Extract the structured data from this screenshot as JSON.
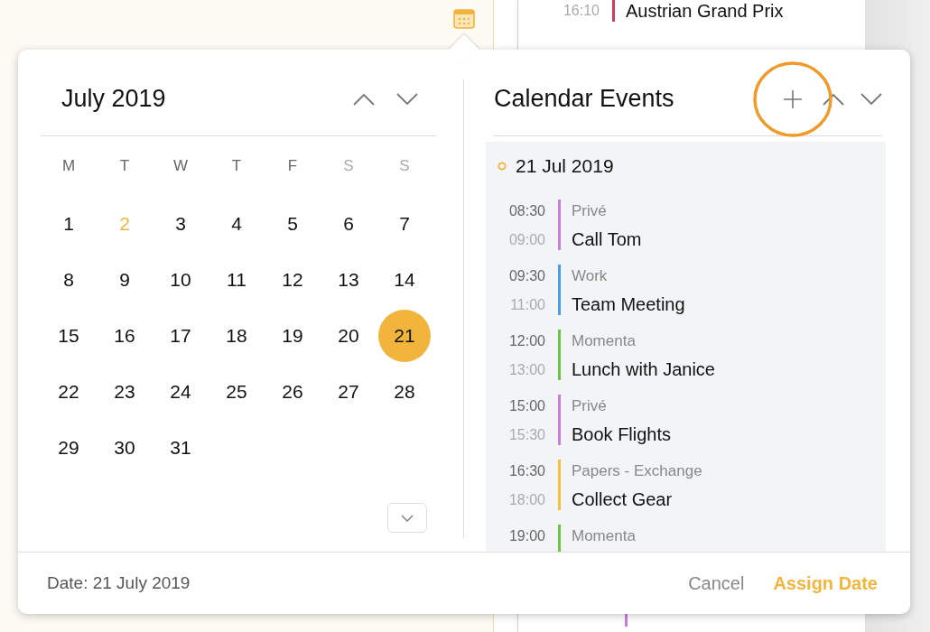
{
  "background": {
    "event_above": {
      "time": "16:10",
      "title": "Austrian Grand Prix",
      "color": "#d8365c"
    },
    "event_below": {
      "color": "#c77fd9"
    }
  },
  "calendar": {
    "month": "July 2019",
    "weekdays": [
      {
        "label": "M",
        "weekend": false
      },
      {
        "label": "T",
        "weekend": false
      },
      {
        "label": "W",
        "weekend": false
      },
      {
        "label": "T",
        "weekend": false
      },
      {
        "label": "F",
        "weekend": false
      },
      {
        "label": "S",
        "weekend": true
      },
      {
        "label": "S",
        "weekend": true
      }
    ],
    "weeks": [
      [
        {
          "label": "1",
          "today": false,
          "selected": false
        },
        {
          "label": "2",
          "today": true,
          "selected": false
        },
        {
          "label": "3",
          "today": false,
          "selected": false
        },
        {
          "label": "4",
          "today": false,
          "selected": false
        },
        {
          "label": "5",
          "today": false,
          "selected": false
        },
        {
          "label": "6",
          "today": false,
          "selected": false
        },
        {
          "label": "7",
          "today": false,
          "selected": false
        }
      ],
      [
        {
          "label": "8",
          "today": false,
          "selected": false
        },
        {
          "label": "9",
          "today": false,
          "selected": false
        },
        {
          "label": "10",
          "today": false,
          "selected": false
        },
        {
          "label": "11",
          "today": false,
          "selected": false
        },
        {
          "label": "12",
          "today": false,
          "selected": false
        },
        {
          "label": "13",
          "today": false,
          "selected": false
        },
        {
          "label": "14",
          "today": false,
          "selected": false
        }
      ],
      [
        {
          "label": "15",
          "today": false,
          "selected": false
        },
        {
          "label": "16",
          "today": false,
          "selected": false
        },
        {
          "label": "17",
          "today": false,
          "selected": false
        },
        {
          "label": "18",
          "today": false,
          "selected": false
        },
        {
          "label": "19",
          "today": false,
          "selected": false
        },
        {
          "label": "20",
          "today": false,
          "selected": false
        },
        {
          "label": "21",
          "today": false,
          "selected": true
        }
      ],
      [
        {
          "label": "22",
          "today": false,
          "selected": false
        },
        {
          "label": "23",
          "today": false,
          "selected": false
        },
        {
          "label": "24",
          "today": false,
          "selected": false
        },
        {
          "label": "25",
          "today": false,
          "selected": false
        },
        {
          "label": "26",
          "today": false,
          "selected": false
        },
        {
          "label": "27",
          "today": false,
          "selected": false
        },
        {
          "label": "28",
          "today": false,
          "selected": false
        }
      ],
      [
        {
          "label": "29",
          "today": false,
          "selected": false
        },
        {
          "label": "30",
          "today": false,
          "selected": false
        },
        {
          "label": "31",
          "today": false,
          "selected": false
        }
      ]
    ]
  },
  "events_panel": {
    "title": "Calendar Events",
    "date": "21 Jul 2019",
    "events": [
      {
        "start": "08:30",
        "end": "09:00",
        "category": "Privé",
        "title": "Call Tom",
        "color": "#c77fd9"
      },
      {
        "start": "09:30",
        "end": "11:00",
        "category": "Work",
        "title": "Team Meeting",
        "color": "#4a9ee8"
      },
      {
        "start": "12:00",
        "end": "13:00",
        "category": "Momenta",
        "title": "Lunch with Janice",
        "color": "#6cc644"
      },
      {
        "start": "15:00",
        "end": "15:30",
        "category": "Privé",
        "title": "Book Flights",
        "color": "#c77fd9"
      },
      {
        "start": "16:30",
        "end": "18:00",
        "category": "Papers - Exchange",
        "title": "Collect Gear",
        "color": "#f2c13d"
      },
      {
        "start": "19:00",
        "category": "Momenta",
        "color": "#6cc644"
      }
    ]
  },
  "footer": {
    "date_label": "Date: 21 July 2019",
    "buttons": [
      {
        "label": "Cancel",
        "kind": "secondary"
      },
      {
        "label": "Assign Date",
        "kind": "primary"
      }
    ]
  }
}
